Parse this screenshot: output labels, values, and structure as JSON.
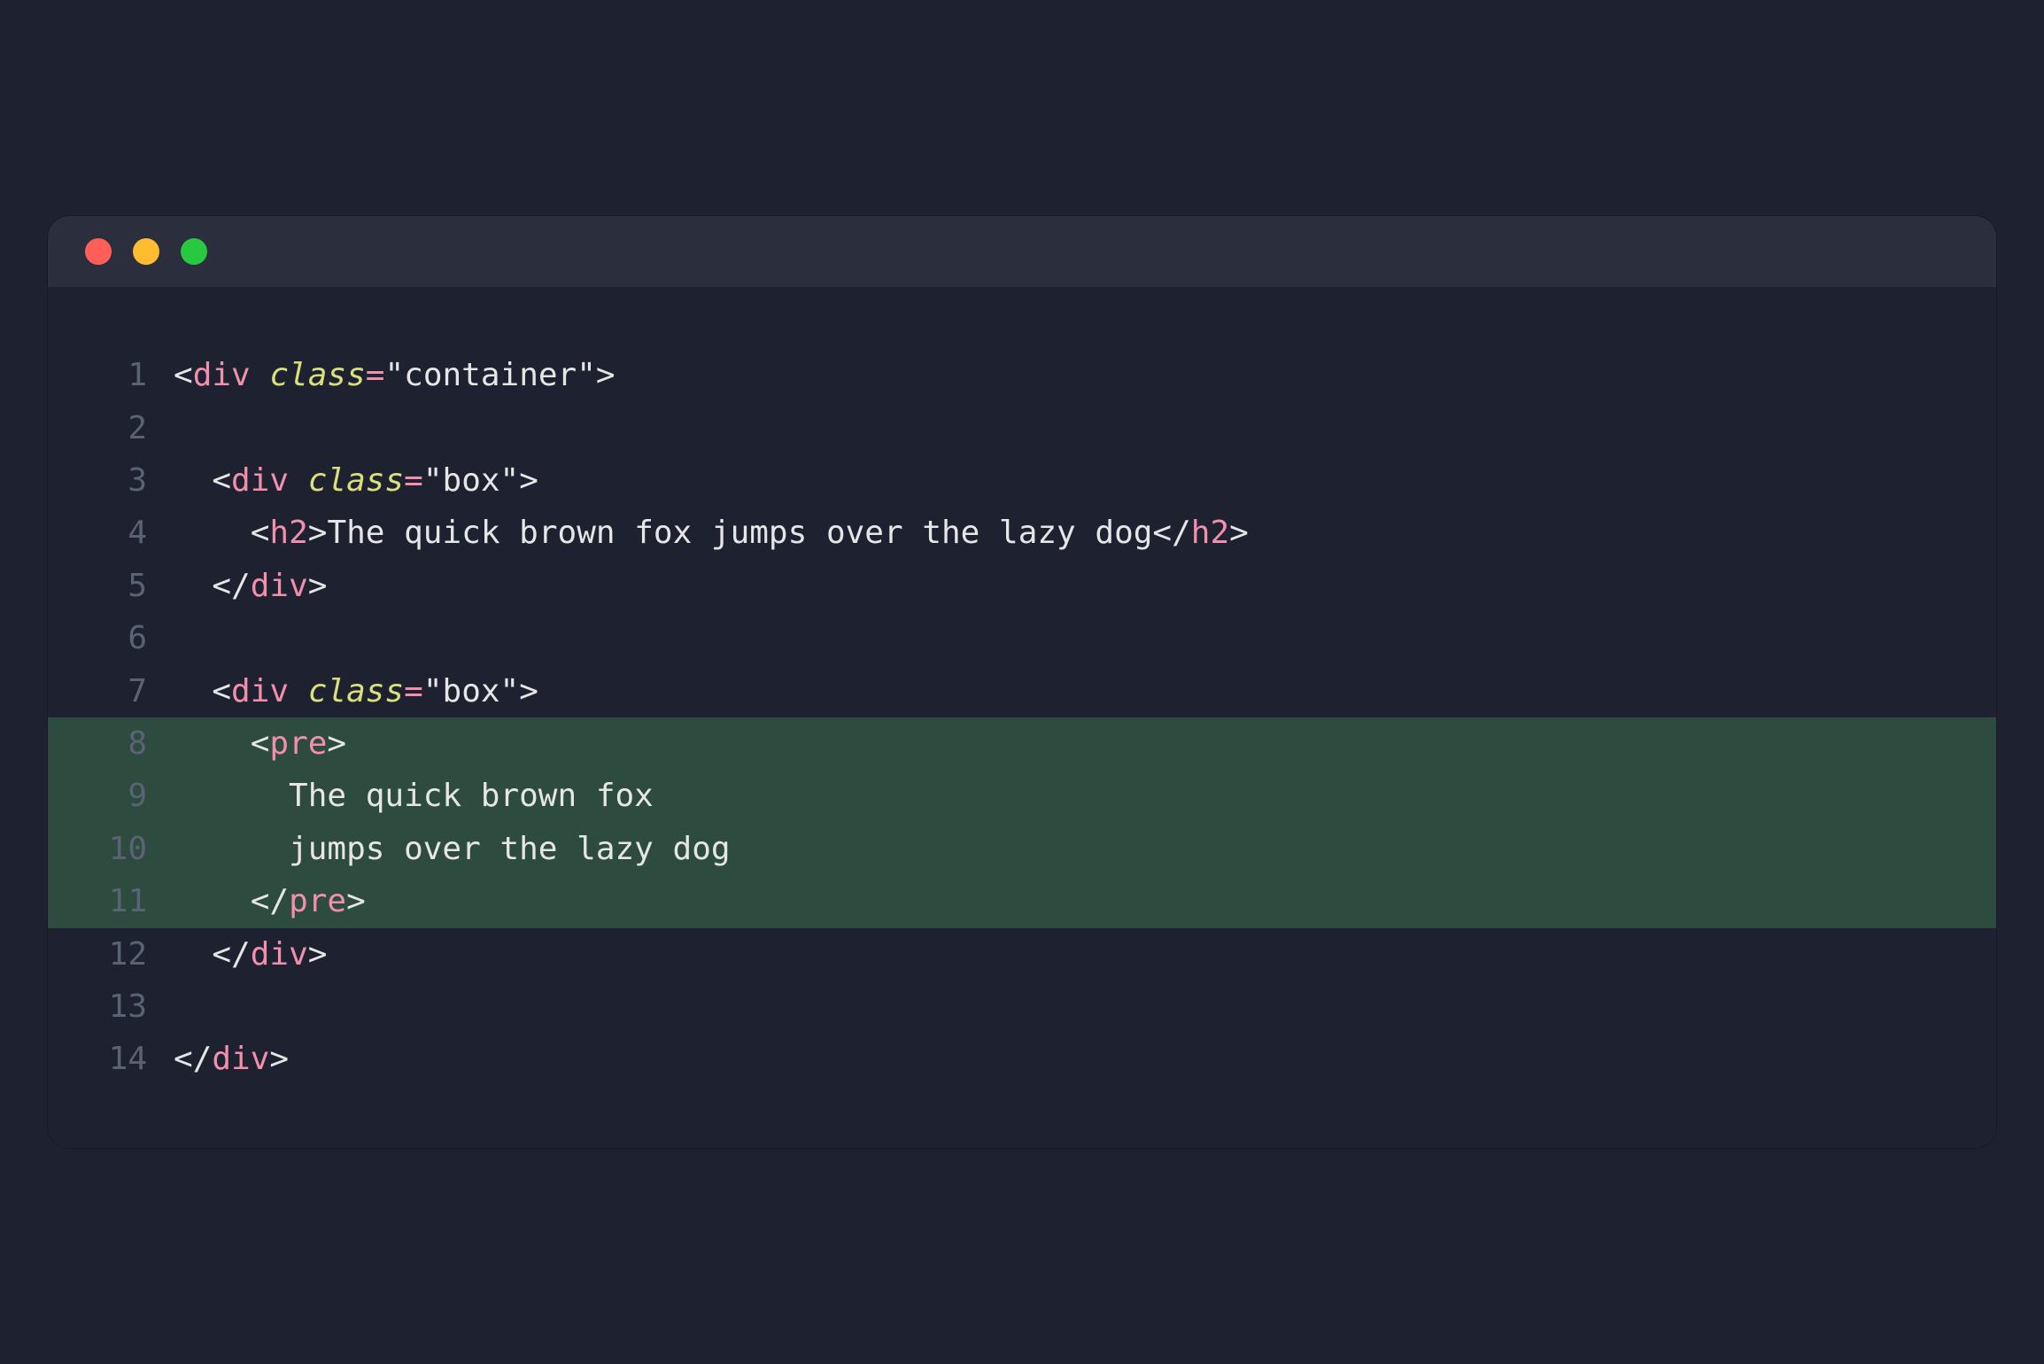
{
  "window": {
    "traffic_lights": [
      "close",
      "minimize",
      "zoom"
    ]
  },
  "editor": {
    "highlighted_lines": [
      8,
      9,
      10,
      11
    ],
    "lines": [
      {
        "num": "1",
        "tokens": [
          {
            "t": "punct",
            "v": "<"
          },
          {
            "t": "tag",
            "v": "div"
          },
          {
            "t": "txt",
            "v": " "
          },
          {
            "t": "attr",
            "v": "class"
          },
          {
            "t": "op",
            "v": "="
          },
          {
            "t": "punct",
            "v": "\""
          },
          {
            "t": "str",
            "v": "container"
          },
          {
            "t": "punct",
            "v": "\""
          },
          {
            "t": "punct",
            "v": ">"
          }
        ]
      },
      {
        "num": "2",
        "tokens": []
      },
      {
        "num": "3",
        "tokens": [
          {
            "t": "txt",
            "v": "  "
          },
          {
            "t": "punct",
            "v": "<"
          },
          {
            "t": "tag",
            "v": "div"
          },
          {
            "t": "txt",
            "v": " "
          },
          {
            "t": "attr",
            "v": "class"
          },
          {
            "t": "op",
            "v": "="
          },
          {
            "t": "punct",
            "v": "\""
          },
          {
            "t": "str",
            "v": "box"
          },
          {
            "t": "punct",
            "v": "\""
          },
          {
            "t": "punct",
            "v": ">"
          }
        ]
      },
      {
        "num": "4",
        "tokens": [
          {
            "t": "txt",
            "v": "    "
          },
          {
            "t": "punct",
            "v": "<"
          },
          {
            "t": "tag",
            "v": "h2"
          },
          {
            "t": "punct",
            "v": ">"
          },
          {
            "t": "txt",
            "v": "The quick brown fox jumps over the lazy dog"
          },
          {
            "t": "punct",
            "v": "</"
          },
          {
            "t": "tag",
            "v": "h2"
          },
          {
            "t": "punct",
            "v": ">"
          }
        ]
      },
      {
        "num": "5",
        "tokens": [
          {
            "t": "txt",
            "v": "  "
          },
          {
            "t": "punct",
            "v": "</"
          },
          {
            "t": "tag",
            "v": "div"
          },
          {
            "t": "punct",
            "v": ">"
          }
        ]
      },
      {
        "num": "6",
        "tokens": []
      },
      {
        "num": "7",
        "tokens": [
          {
            "t": "txt",
            "v": "  "
          },
          {
            "t": "punct",
            "v": "<"
          },
          {
            "t": "tag",
            "v": "div"
          },
          {
            "t": "txt",
            "v": " "
          },
          {
            "t": "attr",
            "v": "class"
          },
          {
            "t": "op",
            "v": "="
          },
          {
            "t": "punct",
            "v": "\""
          },
          {
            "t": "str",
            "v": "box"
          },
          {
            "t": "punct",
            "v": "\""
          },
          {
            "t": "punct",
            "v": ">"
          }
        ]
      },
      {
        "num": "8",
        "tokens": [
          {
            "t": "txt",
            "v": "    "
          },
          {
            "t": "punct",
            "v": "<"
          },
          {
            "t": "tag",
            "v": "pre"
          },
          {
            "t": "punct",
            "v": ">"
          }
        ]
      },
      {
        "num": "9",
        "tokens": [
          {
            "t": "txt",
            "v": "      The quick brown fox"
          }
        ]
      },
      {
        "num": "10",
        "tokens": [
          {
            "t": "txt",
            "v": "      jumps over the lazy dog"
          }
        ]
      },
      {
        "num": "11",
        "tokens": [
          {
            "t": "txt",
            "v": "    "
          },
          {
            "t": "punct",
            "v": "</"
          },
          {
            "t": "tag",
            "v": "pre"
          },
          {
            "t": "punct",
            "v": ">"
          }
        ]
      },
      {
        "num": "12",
        "tokens": [
          {
            "t": "txt",
            "v": "  "
          },
          {
            "t": "punct",
            "v": "</"
          },
          {
            "t": "tag",
            "v": "div"
          },
          {
            "t": "punct",
            "v": ">"
          }
        ]
      },
      {
        "num": "13",
        "tokens": []
      },
      {
        "num": "14",
        "tokens": [
          {
            "t": "punct",
            "v": "</"
          },
          {
            "t": "tag",
            "v": "div"
          },
          {
            "t": "punct",
            "v": ">"
          }
        ]
      }
    ]
  }
}
